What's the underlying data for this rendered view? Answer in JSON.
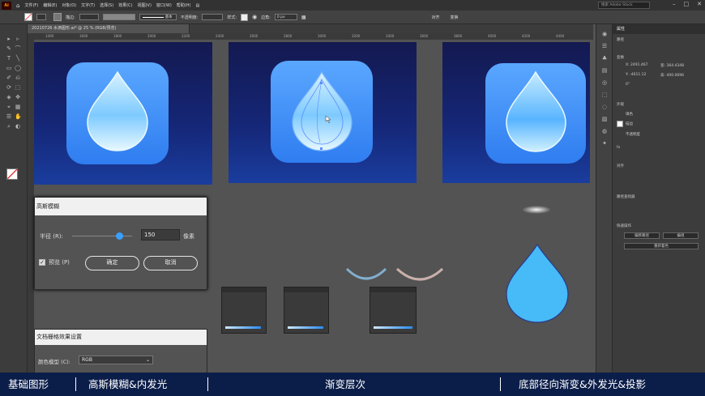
{
  "menubar": {
    "app_logo": "Ai",
    "items": [
      "文件(F)",
      "编辑(E)",
      "对象(O)",
      "文字(T)",
      "选择(S)",
      "效果(C)",
      "视图(V)",
      "窗口(W)",
      "帮助(H)"
    ],
    "search_placeholder": "搜索 Adobe Stock"
  },
  "controlbar": {
    "stroke_label": "描边:",
    "stroke_style": "基本",
    "opacity_label": "不透明度:",
    "style_label": "样式:",
    "corner_label": "边角:",
    "corner_value": "0 px",
    "align_label": "对齐",
    "transform_label": "变换"
  },
  "document": {
    "tab_label": "20210726 水滴图形.ai* @ 25 % (RGB/预览)"
  },
  "ruler": {
    "ticks": [
      "1400",
      "1600",
      "1800",
      "2000",
      "2200",
      "2400",
      "2600",
      "2800",
      "3000",
      "3200",
      "3400",
      "3600",
      "3800",
      "4000",
      "4200",
      "4400"
    ]
  },
  "properties_panel": {
    "title": "属性",
    "section_path": "路径",
    "section_transform": "变换",
    "x_label": "X:",
    "x_value": "2491.467",
    "w_label": "宽:",
    "w_value": "364.4348",
    "y_label": "Y:",
    "y_value": "-4611.12",
    "h_label": "高:",
    "h_value": "400.0696",
    "angle_value": "0°",
    "section_appearance": "外观",
    "fill_label": "填色",
    "stroke_label": "描边",
    "opacity_label": "不透明度",
    "fx_label": "fx",
    "section_align": "对齐",
    "section_pathfinder": "路径查找器",
    "section_quick": "快速操作",
    "btn_offset_path": "偏移路径",
    "btn_edit": "编组",
    "btn_recolor": "重新着色"
  },
  "dialog_blur": {
    "title": "高斯模糊",
    "radius_label": "半径 (R):",
    "radius_value": "150",
    "unit": "像素",
    "preview_label": "预览 (P)",
    "ok": "确定",
    "cancel": "取消",
    "slider_fraction": 0.78
  },
  "dialog_raster": {
    "title": "文档栅格效果设置",
    "color_model_label": "颜色模型 (C):",
    "color_model_value": "RGB"
  },
  "bottom_captions": [
    "基础图形",
    "高斯模糊&内发光",
    "渐变层次",
    "底部径向渐变&外发光&投影"
  ],
  "colors": {
    "accent": "#2f7df0",
    "drop_blue": "#46bbf7",
    "banner_bg": "#0b1d49"
  }
}
